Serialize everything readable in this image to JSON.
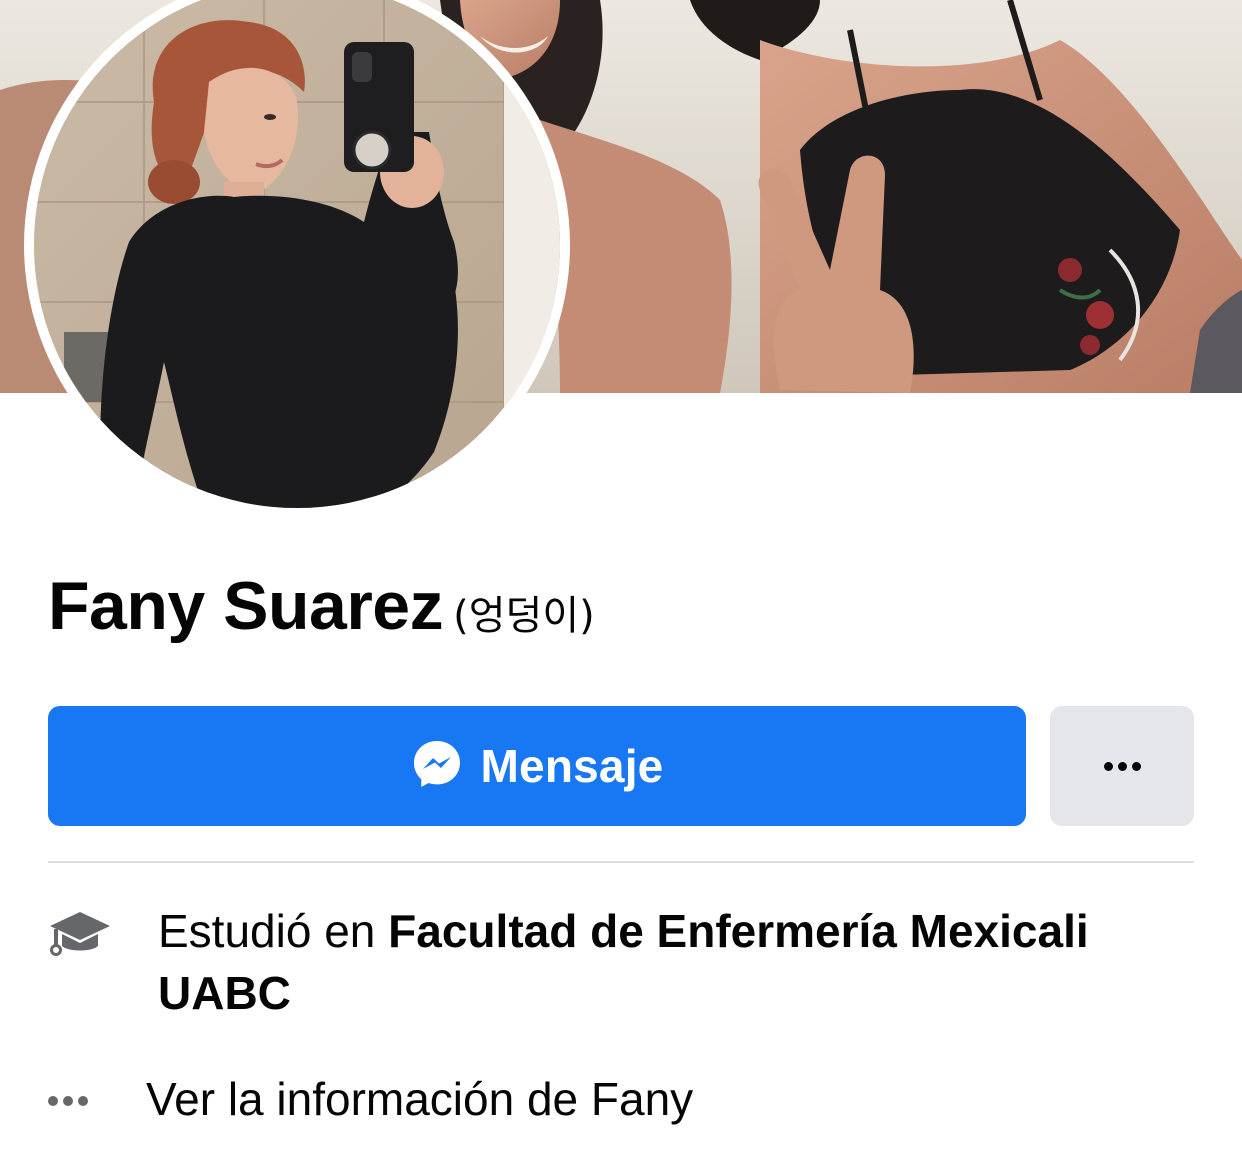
{
  "profile": {
    "name": "Fany Suarez",
    "alternate_name": "(엉덩이)"
  },
  "actions": {
    "message_label": "Mensaje",
    "message_icon": "messenger-icon",
    "more_icon": "more-dots-icon"
  },
  "intro": {
    "education": {
      "icon": "graduation-cap-icon",
      "prefix": "Estudió en",
      "school": "Facultad de Enfermería Mexicali UABC"
    },
    "more_info": {
      "icon": "more-dots-icon",
      "label": "Ver la información de Fany"
    }
  },
  "colors": {
    "primary_button": "#1877f2",
    "secondary_button": "#e4e6eb",
    "divider": "#dadde1",
    "icon_gray": "#65676b",
    "text": "#050505"
  }
}
